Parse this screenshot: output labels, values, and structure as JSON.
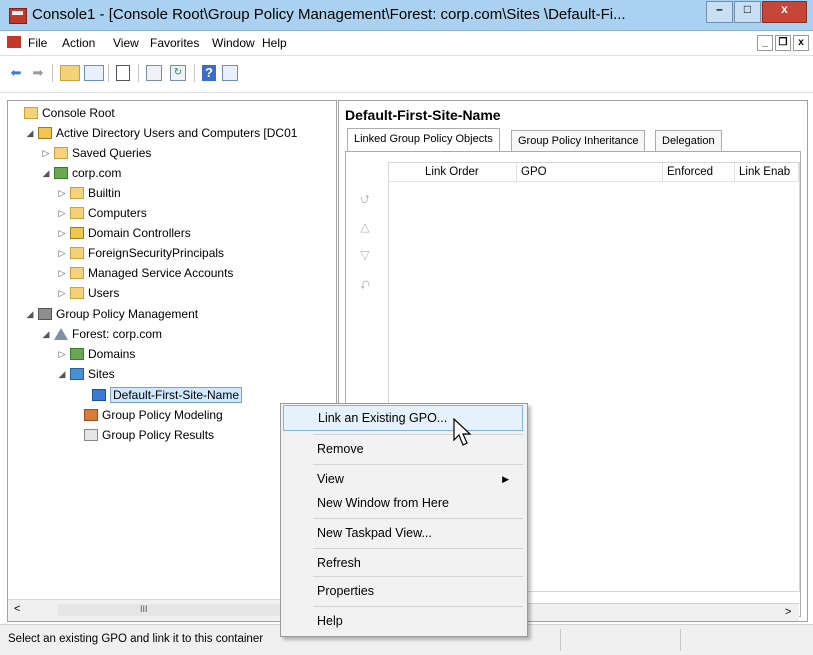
{
  "window": {
    "title": "Console1 - [Console Root\\Group Policy Management\\Forest: corp.com\\Sites \\Default-Fi...",
    "minimize": "–",
    "maximize": "□",
    "close": "x"
  },
  "menubar": {
    "items": [
      "File",
      "Action",
      "View",
      "Favorites",
      "Window",
      "Help"
    ],
    "mdi_min": "_",
    "mdi_restore": "❐",
    "mdi_close": "x"
  },
  "toolbar": {
    "icons": [
      "back-icon",
      "forward-icon",
      "up-folder-icon",
      "show-hide-tree-icon",
      "properties-icon",
      "export-icon",
      "refresh-icon",
      "help-icon",
      "action-pane-icon"
    ]
  },
  "tree": {
    "items": [
      {
        "label": "Console Root",
        "icon": "console-root-icon"
      },
      {
        "label": "Active Directory Users and Computers [DC01",
        "icon": "ad-users-computers-icon"
      },
      {
        "label": "Saved Queries",
        "icon": "folder-icon"
      },
      {
        "label": "corp.com",
        "icon": "domain-icon"
      },
      {
        "label": "Builtin",
        "icon": "folder-icon"
      },
      {
        "label": "Computers",
        "icon": "folder-icon"
      },
      {
        "label": "Domain Controllers",
        "icon": "ou-icon"
      },
      {
        "label": "ForeignSecurityPrincipals",
        "icon": "folder-icon"
      },
      {
        "label": "Managed Service Accounts",
        "icon": "folder-icon"
      },
      {
        "label": "Users",
        "icon": "folder-icon"
      },
      {
        "label": "Group Policy Management",
        "icon": "group-policy-management-icon"
      },
      {
        "label": "Forest: corp.com",
        "icon": "forest-icon"
      },
      {
        "label": "Domains",
        "icon": "domains-icon"
      },
      {
        "label": "Sites",
        "icon": "sites-icon"
      },
      {
        "label": "Default-First-Site-Name",
        "icon": "site-icon"
      },
      {
        "label": "Group Policy Modeling",
        "icon": "gp-modeling-icon"
      },
      {
        "label": "Group Policy Results",
        "icon": "gp-results-icon"
      }
    ],
    "scroll_label": "III",
    "scroll_left": "<"
  },
  "right_pane": {
    "title": "Default-First-Site-Name",
    "tabs": [
      "Linked Group Policy Objects",
      "Group Policy Inheritance",
      "Delegation"
    ],
    "columns": [
      "Link Order",
      "GPO",
      "Enforced",
      "Link Enab"
    ],
    "scroll_right": ">"
  },
  "context_menu": {
    "items": [
      "Link an Existing GPO...",
      "Remove",
      "View",
      "New Window from Here",
      "New Taskpad View...",
      "Refresh",
      "Properties",
      "Help"
    ],
    "highlighted": "Link an Existing GPO..."
  },
  "statusbar": {
    "text": "Select an existing GPO and link it to this container"
  }
}
